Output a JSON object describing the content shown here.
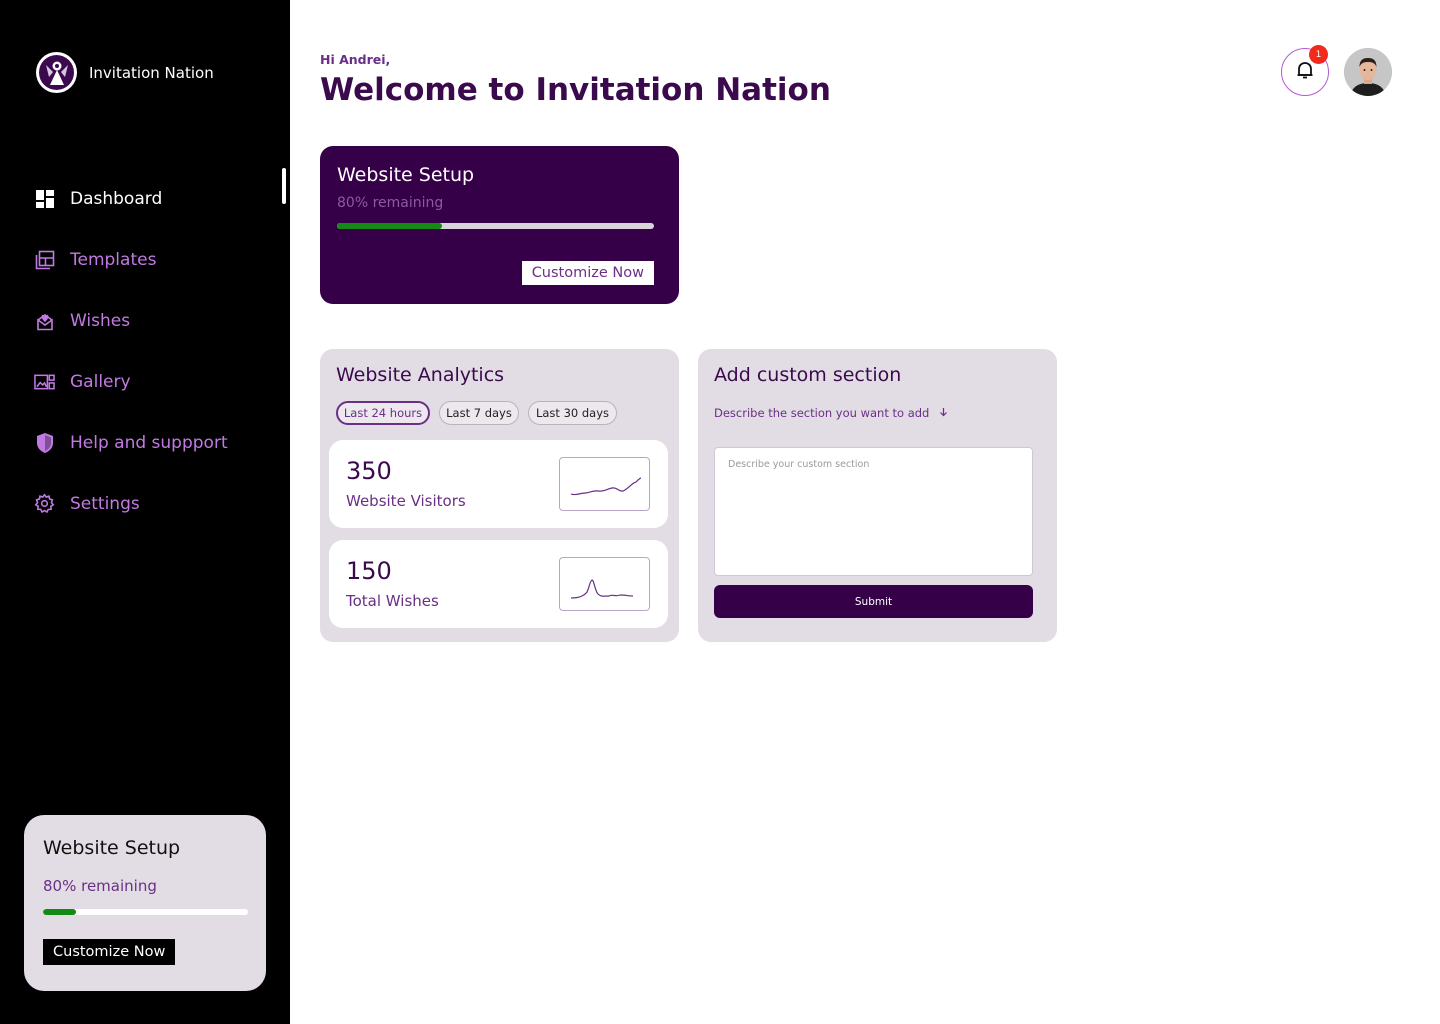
{
  "brand": {
    "name": "Invitation Nation",
    "logo_icon": "fairy-logo-icon"
  },
  "sidebar": {
    "items": [
      {
        "label": "Dashboard",
        "icon": "dashboard-icon",
        "active": true
      },
      {
        "label": "Templates",
        "icon": "templates-icon",
        "active": false
      },
      {
        "label": "Wishes",
        "icon": "wishes-icon",
        "active": false
      },
      {
        "label": "Gallery",
        "icon": "gallery-icon",
        "active": false
      },
      {
        "label": "Help and suppport",
        "icon": "shield-icon",
        "active": false
      },
      {
        "label": "Settings",
        "icon": "gear-icon",
        "active": false
      }
    ],
    "setup_card": {
      "title": "Website Setup",
      "subtitle": "80% remaining",
      "progress": 0.16,
      "button_label": "Customize Now"
    }
  },
  "header": {
    "greeting": "Hi Andrei,",
    "title": "Welcome to Invitation Nation",
    "notification_count": "1"
  },
  "setup_card": {
    "title": "Website Setup",
    "subtitle": "80% remaining",
    "progress": 0.33,
    "button_label": "Customize Now"
  },
  "analytics": {
    "title": "Website Analytics",
    "ranges": [
      "Last 24 hours",
      "Last 7 days",
      "Last 30 days"
    ],
    "active_range": "Last 24 hours",
    "stats": [
      {
        "value": "350",
        "label": "Website Visitors"
      },
      {
        "value": "150",
        "label": "Total Wishes"
      }
    ]
  },
  "custom_section": {
    "title": "Add custom section",
    "hint": "Describe the section you want to add",
    "placeholder": "Describe your custom section",
    "submit_label": "Submit"
  },
  "colors": {
    "sidebar_bg": "#000000",
    "accent": "#360049",
    "nav_text": "#c27ae3",
    "progress": "#128a14",
    "card_bg": "#e2dde4",
    "badge": "#f02b1d"
  }
}
